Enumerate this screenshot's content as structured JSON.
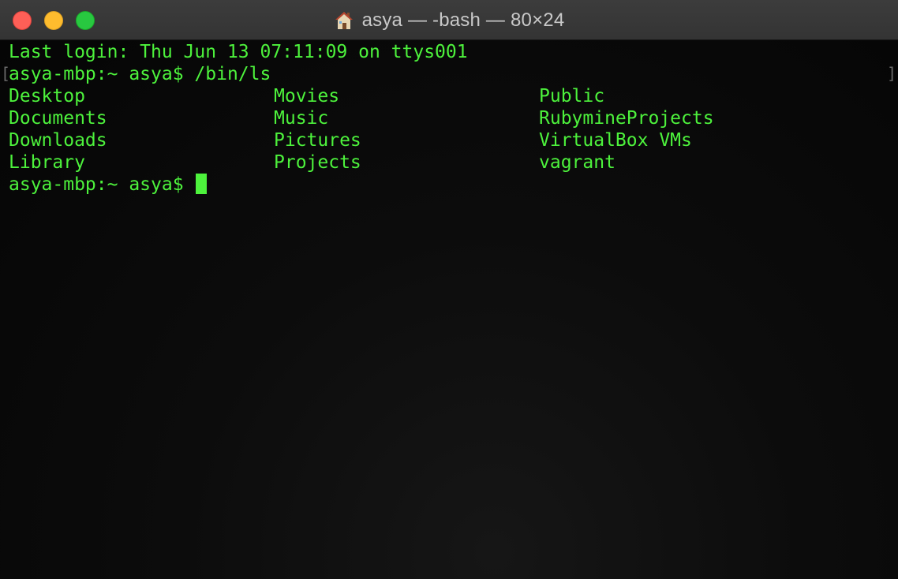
{
  "window": {
    "title": "asya — -bash — 80×24",
    "title_icon": "home-icon",
    "colors": {
      "close": "#fe5f57",
      "minimize": "#febc2e",
      "zoom": "#28c840",
      "text": "#4df23c",
      "background": "#0b0b0b"
    }
  },
  "terminal": {
    "last_login": "Last login: Thu Jun 13 07:11:09 on ttys001",
    "prompt_command": {
      "prompt": "asya-mbp:~ asya$",
      "command": "/bin/ls"
    },
    "ls_output": [
      [
        "Desktop",
        "Movies",
        "Public"
      ],
      [
        "Documents",
        "Music",
        "RubymineProjects"
      ],
      [
        "Downloads",
        "Pictures",
        "VirtualBox VMs"
      ],
      [
        "Library",
        "Projects",
        "vagrant"
      ]
    ],
    "current_prompt": "asya-mbp:~ asya$",
    "bracket_left": "[",
    "bracket_right": "]"
  }
}
